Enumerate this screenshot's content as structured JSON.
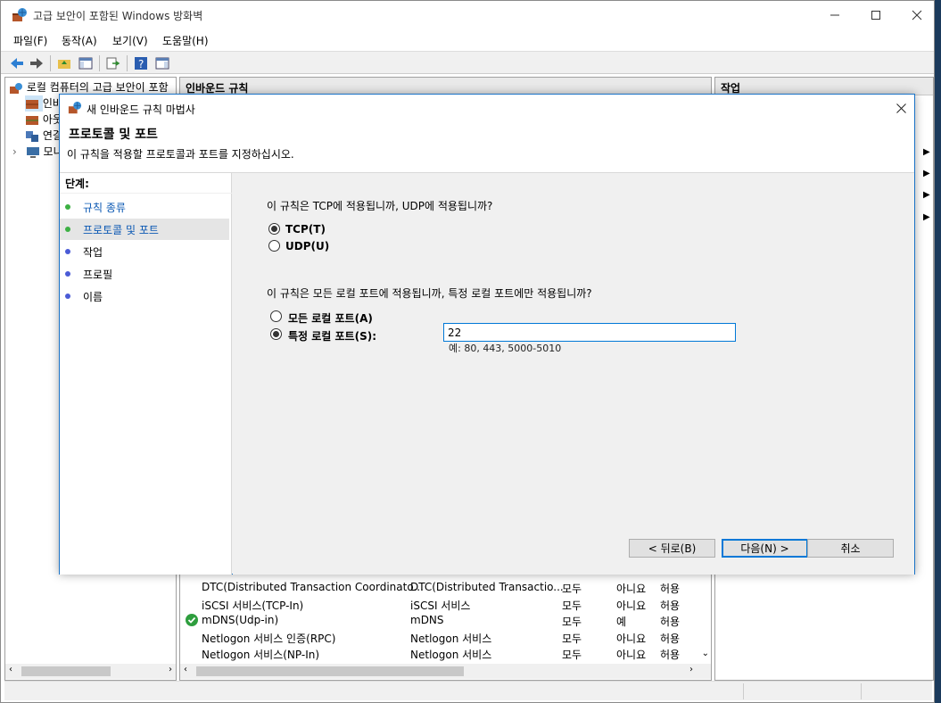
{
  "main_window": {
    "title": "고급 보안이 포함된 Windows 방화벽",
    "menu": [
      "파일(F)",
      "동작(A)",
      "보기(V)",
      "도움말(H)"
    ],
    "tree": {
      "root": "로컬 컴퓨터의 고급 보안이 포함",
      "items": [
        "인바",
        "아웃",
        "연결",
        "모니"
      ]
    },
    "center_header": "인바운드 규칙",
    "actions_header": "작업",
    "rules": [
      {
        "name": "DTC(Distributed Transaction Coordinato...",
        "group": "DTC(Distributed Transactio...",
        "profile": "모두",
        "enabled": "아니요",
        "action": "허용",
        "check": false
      },
      {
        "name": "iSCSI 서비스(TCP-In)",
        "group": "iSCSI 서비스",
        "profile": "모두",
        "enabled": "아니요",
        "action": "허용",
        "check": false
      },
      {
        "name": "mDNS(Udp-in)",
        "group": "mDNS",
        "profile": "모두",
        "enabled": "예",
        "action": "허용",
        "check": true
      },
      {
        "name": "Netlogon 서비스 인증(RPC)",
        "group": "Netlogon 서비스",
        "profile": "모두",
        "enabled": "아니요",
        "action": "허용",
        "check": false
      },
      {
        "name": "Netlogon 서비스(NP-In)",
        "group": "Netlogon 서비스",
        "profile": "모두",
        "enabled": "아니요",
        "action": "허용",
        "check": false
      }
    ]
  },
  "dialog": {
    "title": "새 인바운드 규칙 마법사",
    "heading": "프로토콜 및 포트",
    "subheading": "이 규칙을 적용할 프로토콜과 포트를 지정하십시오.",
    "steps_header": "단계:",
    "steps": [
      {
        "label": "규칙 종류",
        "state": "done"
      },
      {
        "label": "프로토콜 및 포트",
        "state": "current"
      },
      {
        "label": "작업",
        "state": "pending"
      },
      {
        "label": "프로필",
        "state": "pending"
      },
      {
        "label": "이름",
        "state": "pending"
      }
    ],
    "protocol_question": "이 규칙은 TCP에 적용됩니까, UDP에 적용됩니까?",
    "tcp_label": "TCP(T)",
    "udp_label": "UDP(U)",
    "selected_protocol": "TCP",
    "port_question": "이 규칙은 모든 로컬 포트에 적용됩니까, 특정 로컬 포트에만 적용됩니까?",
    "all_ports_label": "모든 로컬 포트(A)",
    "specific_ports_label": "특정 로컬 포트(S):",
    "selected_port_option": "specific",
    "port_value": "22",
    "port_hint": "예: 80, 443, 5000-5010",
    "back_label": "< 뒤로(B)",
    "next_label": "다음(N) >",
    "cancel_label": "취소"
  },
  "colors": {
    "accent": "#0078d7",
    "step_done": "#3cb043",
    "step_pending": "#4a5bd6",
    "selected_step_bg": "#e5e5e5"
  }
}
